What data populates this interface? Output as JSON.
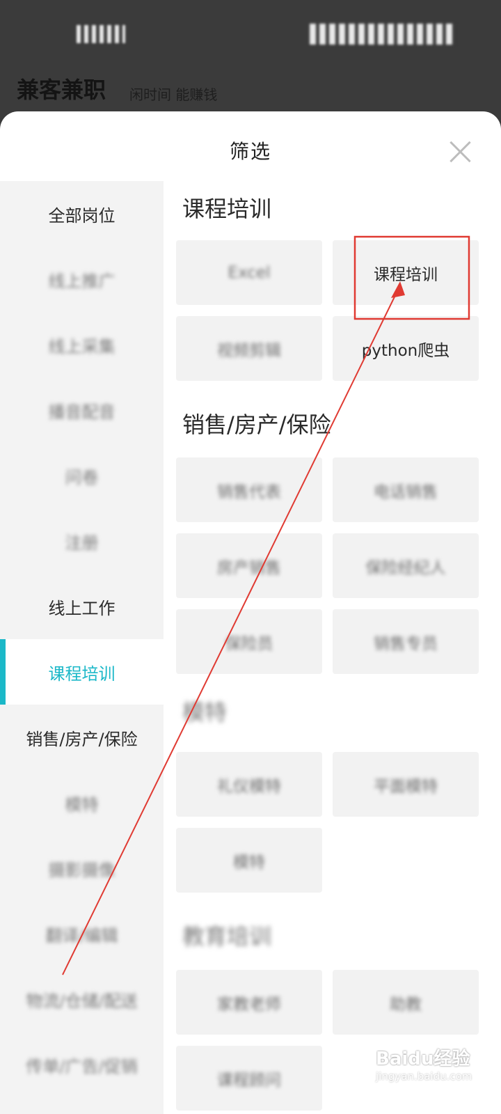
{
  "status_bar": {
    "time": "12:3?",
    "icons": "signal-wifi-battery"
  },
  "app": {
    "title": "兼客兼职",
    "slogan": "闲时间 能赚钱"
  },
  "sheet": {
    "title": "筛选",
    "close_icon": "close-icon"
  },
  "sidebar": {
    "items": [
      {
        "label": "全部岗位",
        "blurred": false,
        "active": false
      },
      {
        "label": "线上推广",
        "blurred": true,
        "active": false
      },
      {
        "label": "线上采集",
        "blurred": true,
        "active": false
      },
      {
        "label": "播音配音",
        "blurred": true,
        "active": false
      },
      {
        "label": "问卷",
        "blurred": true,
        "active": false
      },
      {
        "label": "注册",
        "blurred": true,
        "active": false
      },
      {
        "label": "线上工作",
        "blurred": false,
        "active": false
      },
      {
        "label": "课程培训",
        "blurred": false,
        "active": true
      },
      {
        "label": "销售/房产/保险",
        "blurred": false,
        "active": false
      },
      {
        "label": "模特",
        "blurred": true,
        "active": false
      },
      {
        "label": "摄影摄像",
        "blurred": true,
        "active": false
      },
      {
        "label": "翻译/编辑",
        "blurred": true,
        "active": false
      },
      {
        "label": "物流/仓储/配送",
        "blurred": true,
        "active": false
      },
      {
        "label": "传单/广告/促销",
        "blurred": true,
        "active": false
      }
    ]
  },
  "sections": [
    {
      "title": "课程培训",
      "blurred": false,
      "chips": [
        {
          "label": "Excel",
          "blurred": true
        },
        {
          "label": "课程培训",
          "blurred": false
        },
        {
          "label": "视频剪辑",
          "blurred": true
        },
        {
          "label": "python爬虫",
          "blurred": false
        }
      ]
    },
    {
      "title": "销售/房产/保险",
      "blurred": false,
      "chips": [
        {
          "label": "销售代表",
          "blurred": true
        },
        {
          "label": "电话销售",
          "blurred": true
        },
        {
          "label": "房产销售",
          "blurred": true
        },
        {
          "label": "保险经纪人",
          "blurred": true
        },
        {
          "label": "保险员",
          "blurred": true
        },
        {
          "label": "销售专员",
          "blurred": true
        }
      ]
    },
    {
      "title": "模特",
      "blurred": true,
      "chips": [
        {
          "label": "礼仪模特",
          "blurred": true
        },
        {
          "label": "平面模特",
          "blurred": true
        },
        {
          "label": "模特",
          "blurred": true
        }
      ]
    },
    {
      "title": "教育培训",
      "blurred": true,
      "chips": [
        {
          "label": "家教老师",
          "blurred": true
        },
        {
          "label": "助教",
          "blurred": true
        },
        {
          "label": "课程顾问",
          "blurred": true
        }
      ]
    }
  ],
  "colors": {
    "accent": "#1bb8c8",
    "annotation": "#e03a32",
    "overlay": "#3b3b3b"
  },
  "watermark": {
    "text": "Baidu经验",
    "sub": "jingyan.baidu.com"
  }
}
